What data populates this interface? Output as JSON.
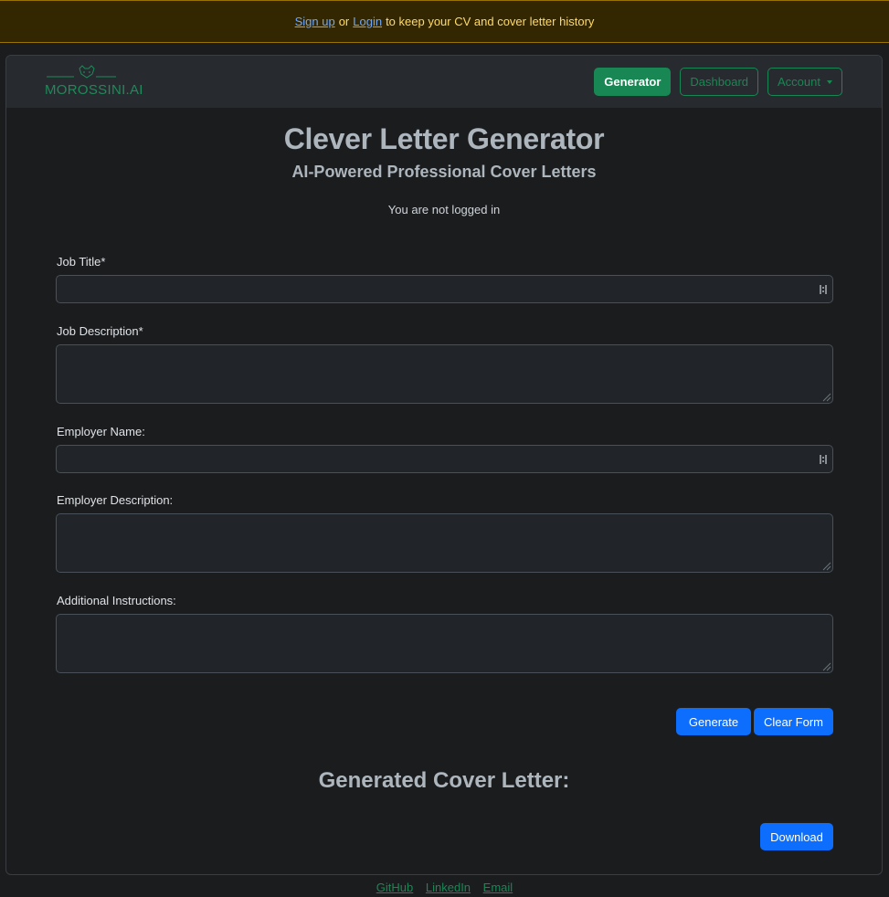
{
  "banner": {
    "signup": "Sign up",
    "or": "or",
    "login": "Login",
    "rest": "to keep your CV and cover letter history"
  },
  "nav": {
    "logo_text": "MOROSSINI.AI",
    "generator": "Generator",
    "dashboard": "Dashboard",
    "account": "Account"
  },
  "header": {
    "title": "Clever Letter Generator",
    "subtitle": "AI-Powered Professional Cover Letters",
    "status": "You are not logged in"
  },
  "form": {
    "job_title_label": "Job Title*",
    "job_title_value": "",
    "job_description_label": "Job Description*",
    "job_description_value": "",
    "employer_name_label": "Employer Name:",
    "employer_name_value": "",
    "employer_description_label": "Employer Description:",
    "employer_description_value": "",
    "additional_label": "Additional Instructions:",
    "additional_value": "",
    "generate": "Generate",
    "clear": "Clear Form"
  },
  "output": {
    "title": "Generated Cover Letter:",
    "download": "Download"
  },
  "footer": {
    "links": [
      "GitHub",
      "LinkedIn",
      "Email"
    ]
  },
  "colors": {
    "accent_green": "#198754",
    "primary_blue": "#0d6efd",
    "banner_bg": "#332701",
    "banner_text": "#ffda6a"
  }
}
